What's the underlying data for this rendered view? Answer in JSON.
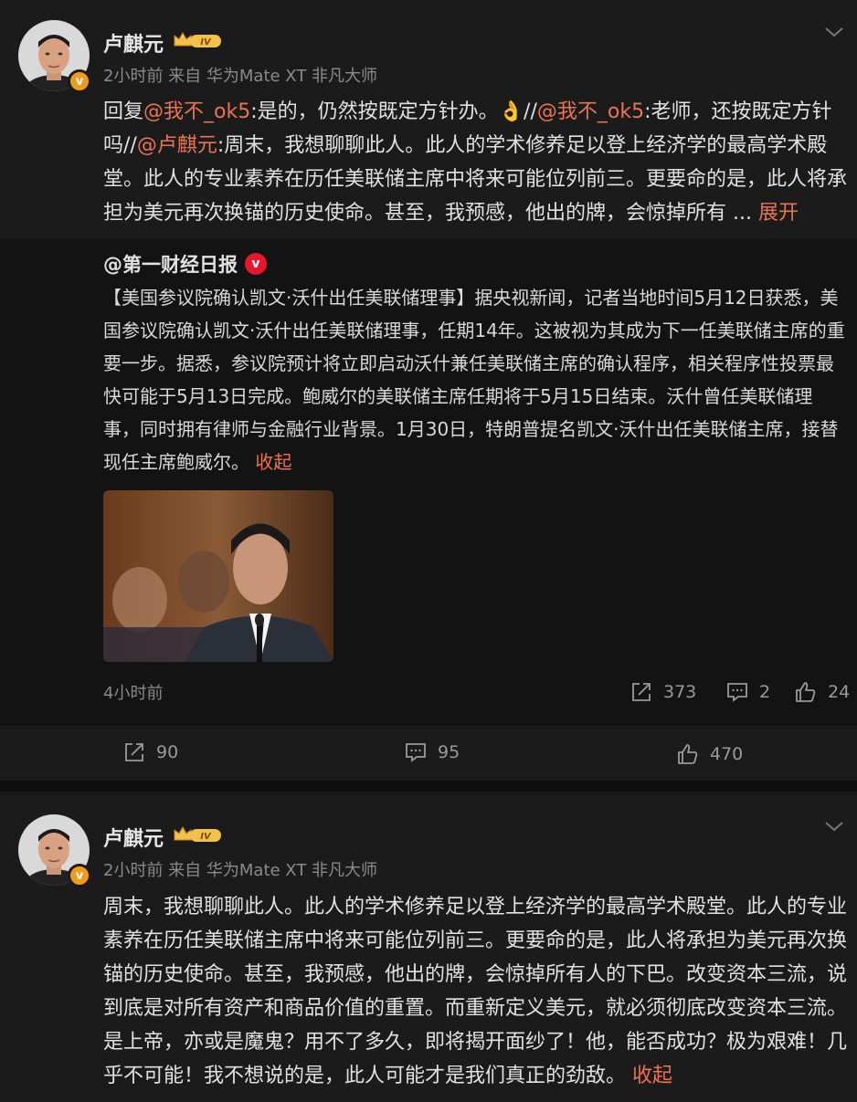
{
  "post1": {
    "username": "卢麒元",
    "level_badge": "IV",
    "verified_mark": "v",
    "meta": "2小时前 来自 华为Mate XT 非凡大师",
    "text_parts": {
      "p1": "回复",
      "m1": "@我不_ok5",
      "p2": ":是的，仍然按既定方针办。",
      "emoji": "👌",
      "p3": "//",
      "m2": "@我不_ok5",
      "p4": ":老师，还按既定方针吗//",
      "m3": "@卢麒元",
      "p5": ":周末，我想聊聊此人。此人的学术修养足以登上经济学的最高学术殿堂。此人的专业素养在历任美联储主席中将来可能位列前三。更要命的是，此人将承担为美元再次换锚的历史使命。甚至，我预感，他出的牌，会惊掉所有 ... ",
      "expand": "展开"
    },
    "repost": {
      "author": "@第一财经日报",
      "verified_mark": "v",
      "text": "【美国参议院确认凯文·沃什出任美联储理事】据央视新闻，记者当地时间5月12日获悉，美国参议院确认凯文·沃什出任美联储理事，任期14年。这被视为其成为下一任美联储主席的重要一步。据悉，参议院预计将立即启动沃什兼任美联储主席的确认程序，相关程序性投票最快可能于5月13日完成。鲍威尔的美联储主席任期将于5月15日结束。沃什曾任美联储理事，同时拥有律师与金融行业背景。1月30日，特朗普提名凯文·沃什出任美联储主席，接替现任主席鲍威尔。 ",
      "collapse": "收起",
      "time": "4小时前",
      "reposts": "373",
      "comments": "2",
      "likes": "24"
    },
    "actions": {
      "reposts": "90",
      "comments": "95",
      "likes": "470"
    }
  },
  "post2": {
    "username": "卢麒元",
    "level_badge": "IV",
    "verified_mark": "v",
    "meta": "2小时前 来自 华为Mate XT 非凡大师",
    "text": "周末，我想聊聊此人。此人的学术修养足以登上经济学的最高学术殿堂。此人的专业素养在历任美联储主席中将来可能位列前三。更要命的是，此人将承担为美元再次换锚的历史使命。甚至，我预感，他出的牌，会惊掉所有人的下巴。改变资本三流，说到底是对所有资产和商品价值的重置。而重新定义美元，就必须彻底改变资本三流。是上帝，亦或是魔鬼？用不了多久，即将揭开面纱了！他，能否成功？极为艰难！几乎不可能！我不想说的是，此人可能才是我们真正的劲敌。 ",
    "collapse": "收起"
  },
  "colors": {
    "accent": "#eb7350",
    "verified_orange": "#f29a1a",
    "verified_red": "#e6162d"
  },
  "icons": [
    "chevron-down-icon",
    "crown-level-icon",
    "repost-icon",
    "comment-icon",
    "like-icon"
  ]
}
